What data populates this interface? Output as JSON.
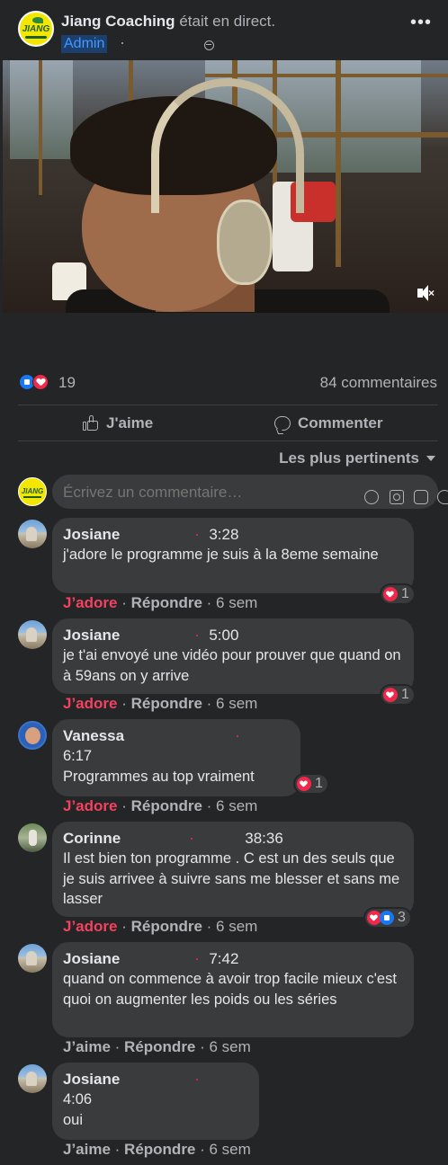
{
  "post": {
    "page_name": "Jiang Coaching",
    "action": "était en direct.",
    "role": "Admin",
    "logo_text": "JIANG"
  },
  "icons": {
    "more": "more-options-icon",
    "visibility": "globe-icon",
    "mute": "muted-speaker-icon"
  },
  "stats": {
    "reaction_count": "19",
    "comments": "84 commentaires"
  },
  "actions": {
    "like": "J'aime",
    "comment": "Commenter"
  },
  "sort": {
    "label": "Les plus pertinents"
  },
  "composer": {
    "placeholder": "Écrivez un commentaire…"
  },
  "comments": [
    {
      "author": "Josiane",
      "time": "3:28",
      "text": "j'adore le programme je suis à la 8eme semaine",
      "reaction": "J’adore",
      "reply": "Répondre",
      "age": "6 sem",
      "badge_count": "1"
    },
    {
      "author": "Josiane",
      "time": "5:00",
      "text": "je t'ai envoyé une vidéo pour prouver que quand on à 59ans on y arrive",
      "reaction": "J’adore",
      "reply": "Répondre",
      "age": "6 sem",
      "badge_count": "1"
    },
    {
      "author": "Vanessa",
      "time": "6:17",
      "text": "Programmes au top vraiment",
      "reaction": "J’adore",
      "reply": "Répondre",
      "age": "6 sem",
      "badge_count": "1"
    },
    {
      "author": "Corinne",
      "time": "38:36",
      "text": "Il est bien ton programme . C est un des seuls que je suis arrivee à suivre sans me blesser et sans me lasser",
      "reaction": "J’adore",
      "reply": "Répondre",
      "age": "6 sem",
      "badge_count": "3"
    },
    {
      "author": "Josiane",
      "time": "7:42",
      "text": "quand on commence à avoir trop facile mieux c'est quoi on augmenter les poids ou les séries",
      "reaction": "J’aime",
      "reply": "Répondre",
      "age": "6 sem"
    },
    {
      "author": "Josiane",
      "time": "4:06",
      "text": "oui",
      "reaction": "J’aime",
      "reply": "Répondre",
      "age": "6 sem"
    }
  ],
  "colors": {
    "background": "#242526",
    "bubble": "#3a3b3c",
    "love": "#f3425f",
    "like": "#1877f2",
    "admin_badge": "#4599ff"
  }
}
